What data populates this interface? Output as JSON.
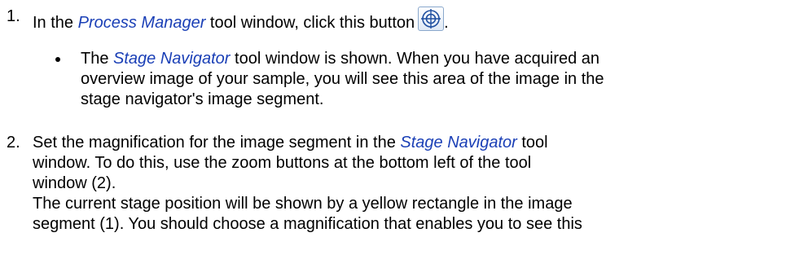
{
  "step1": {
    "number": "1.",
    "text_before": "In the ",
    "term": "Process Manager",
    "text_after": " tool window, click this button",
    "text_end": ".",
    "button_icon": "stage-navigator-crosshair-icon"
  },
  "bullet1": {
    "lines": {
      "l1_before": "The ",
      "l1_term": "Stage Navigator",
      "l1_after": " tool window is shown. When you have acquired an",
      "l2": "overview image of your sample, you will see this area of the image in the",
      "l3": "stage navigator's image segment."
    }
  },
  "step2": {
    "number": "2.",
    "lines": {
      "l1_before": "Set the magnification for the image segment in the ",
      "l1_term": "Stage Navigator",
      "l1_after": " tool",
      "l2": "window. To do this, use the zoom buttons at the bottom left of the tool",
      "l3": "window (2).",
      "l4": "The current stage position will be shown by a yellow rectangle in the image",
      "l5": "segment (1). You should choose a magnification that enables you to see this"
    }
  },
  "colors": {
    "term": "#1a3fb6",
    "text": "#000000",
    "icon_stroke": "#1f4fa0"
  }
}
